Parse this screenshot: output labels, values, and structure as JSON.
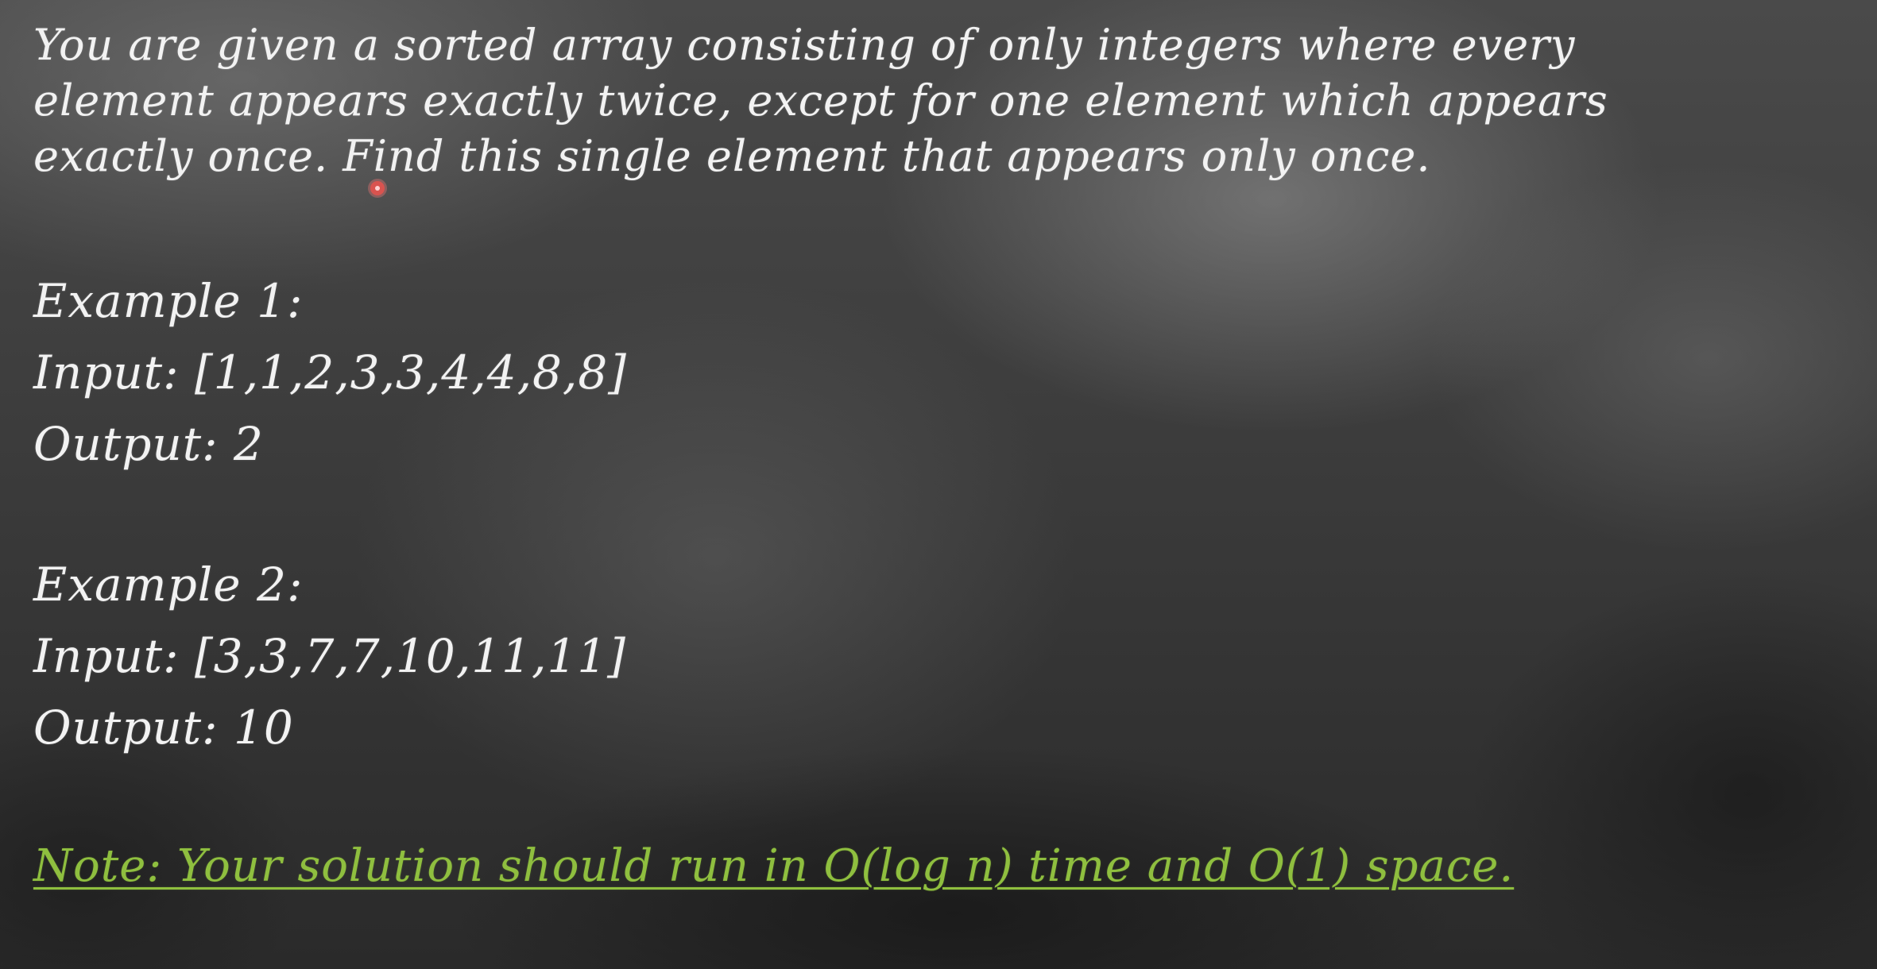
{
  "problem": {
    "line1": "You are given a sorted array consisting of only integers where every",
    "line2": "element appears exactly twice, except for one element which appears",
    "line3": "exactly once. Find this single element that appears only once."
  },
  "example1": {
    "title": "Example 1:",
    "input": "Input: [1,1,2,3,3,4,4,8,8]",
    "output": "Output: 2"
  },
  "example2": {
    "title": "Example 2:",
    "input": "Input: [3,3,7,7,10,11,11]",
    "output": "Output: 10"
  },
  "note": "Note: Your solution should run in O(log n) time and O(1) space.",
  "colors": {
    "text": "#f2f2f2",
    "note": "#8fbf3f",
    "cursor": "#d9534f"
  }
}
